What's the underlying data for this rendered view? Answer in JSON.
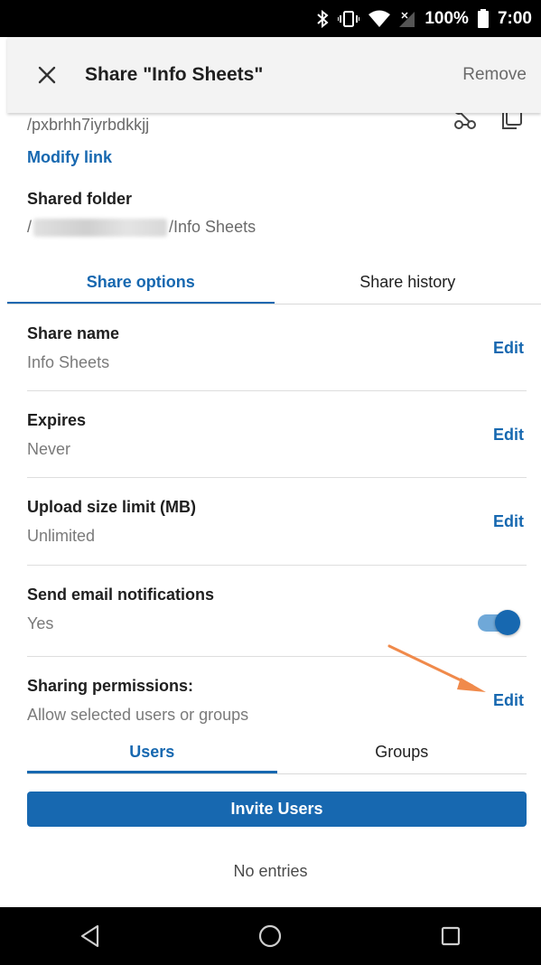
{
  "status_bar": {
    "battery_percent": "100%",
    "time": "7:00",
    "icons": [
      "bluetooth-icon",
      "vibrate-icon",
      "wifi-icon",
      "signal-icon",
      "battery-icon"
    ]
  },
  "app_bar": {
    "title": "Share \"Info Sheets\"",
    "remove_label": "Remove",
    "close_icon": "close-icon"
  },
  "link": {
    "url_tail": "/pxbrhh7iyrbdkkjj",
    "modify_label": "Modify link",
    "actions": [
      "share-icon",
      "copy-icon"
    ]
  },
  "shared_folder": {
    "label": "Shared folder",
    "path_prefix": "/",
    "path_suffix": "/Info Sheets"
  },
  "tabs": [
    {
      "label": "Share options",
      "active": true
    },
    {
      "label": "Share history",
      "active": false
    }
  ],
  "options": [
    {
      "label": "Share name",
      "value": "Info Sheets",
      "action": "Edit"
    },
    {
      "label": "Expires",
      "value": "Never",
      "action": "Edit"
    },
    {
      "label": "Upload size limit (MB)",
      "value": "Unlimited",
      "action": "Edit"
    },
    {
      "label": "Send email notifications",
      "value": "Yes",
      "toggle_on": true
    },
    {
      "label": "Sharing permissions:",
      "value": "Allow selected users or groups",
      "action": "Edit"
    }
  ],
  "sub_tabs": [
    {
      "label": "Users",
      "active": true
    },
    {
      "label": "Groups",
      "active": false
    }
  ],
  "invite_button": "Invite Users",
  "empty_state": "No entries",
  "nav_bar": [
    "back-icon",
    "home-icon",
    "recents-icon"
  ],
  "colors": {
    "accent": "#1768b0",
    "annotation_arrow": "#f08a4b",
    "toggle_track": "#6fa8d8"
  }
}
